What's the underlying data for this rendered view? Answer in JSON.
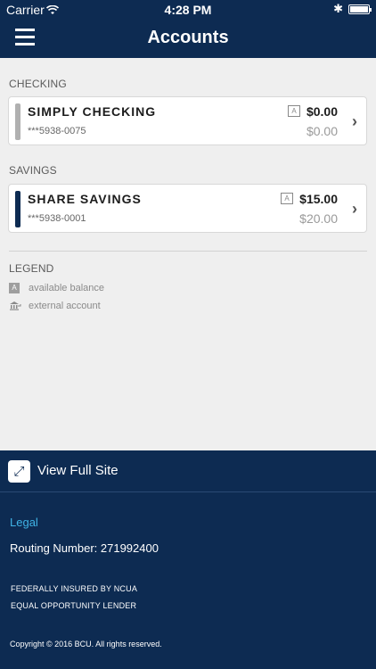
{
  "status_bar": {
    "carrier": "Carrier",
    "time": "4:28 PM"
  },
  "nav": {
    "title": "Accounts"
  },
  "sections": {
    "checking_label": "CHECKING",
    "savings_label": "SAVINGS"
  },
  "accounts": [
    {
      "name": "SIMPLY CHECKING",
      "number": "***5938-0075",
      "available": "$0.00",
      "balance": "$0.00",
      "badge": "A",
      "bar_color": "#b0b0b0"
    },
    {
      "name": "SHARE SAVINGS",
      "number": "***5938-0001",
      "available": "$15.00",
      "balance": "$20.00",
      "badge": "A",
      "bar_color": "#0d2b52"
    }
  ],
  "legend": {
    "title": "LEGEND",
    "items": [
      {
        "icon": "available-balance-icon",
        "badge": "A",
        "label": "available balance"
      },
      {
        "icon": "external-account-icon",
        "label": "external account"
      }
    ]
  },
  "footer": {
    "view_full_site": "View Full Site",
    "legal": "Legal",
    "routing": "Routing Number: 271992400",
    "insured": "FEDERALLY INSURED BY NCUA",
    "equal": "EQUAL OPPORTUNITY LENDER",
    "copyright": "Copyright © 2016 BCU. All rights reserved."
  },
  "colors": {
    "navy": "#0d2b52",
    "link": "#3fb3e6"
  }
}
